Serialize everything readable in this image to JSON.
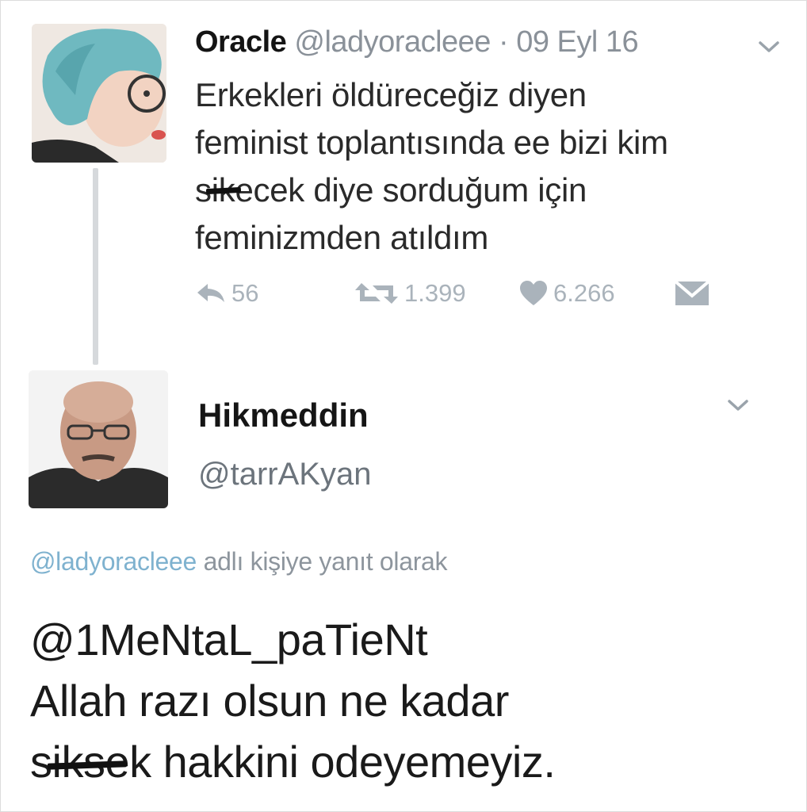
{
  "tweet1": {
    "name": "Oracle",
    "handle": "@ladyoracleee",
    "separator": "·",
    "date": "09 Eyl 16",
    "lines": [
      "Erkekleri öldüreceğiz diyen",
      "feminist toplantısında ee bizi kim",
      "sikecek diye sorduğum için",
      "feminizmden atıldım"
    ],
    "line3_censored": "sik",
    "line3_rest": "ecek diye sorduğum için",
    "actions": {
      "reply_count": "56",
      "retweet_count": "1.399",
      "like_count": "6.266"
    },
    "icons": [
      "reply-icon",
      "retweet-icon",
      "heart-icon",
      "envelope-icon",
      "chevron-down-icon"
    ]
  },
  "tweet2": {
    "name": "Hikmeddin",
    "handle": "@tarrAKyan",
    "reply_context_mention": "@ladyoracleee",
    "reply_context_text": " adlı kişiye yanıt olarak",
    "line1": "@1MeNtaL_paTieNt",
    "line2": "Allah razı olsun ne kadar",
    "line3_censored": "sik",
    "line3_rest": "sek hakkini odeyemeyiz."
  },
  "colors": {
    "muted": "#8a9199",
    "action_gray": "#aab3bb",
    "mention_blue": "#7fb2cf",
    "thread_line": "#d6d9dc"
  }
}
